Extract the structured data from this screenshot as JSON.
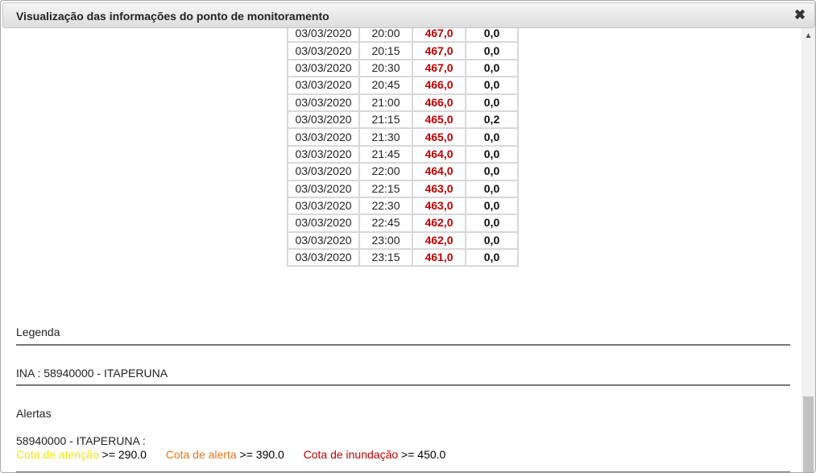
{
  "dialog": {
    "title": "Visualização das informações do ponto de monitoramento",
    "close_glyph": "✖"
  },
  "table": {
    "rows": [
      {
        "date": "03/03/2020",
        "time": "20:00",
        "level": "467,0",
        "rain": "0,0"
      },
      {
        "date": "03/03/2020",
        "time": "20:15",
        "level": "467,0",
        "rain": "0,0"
      },
      {
        "date": "03/03/2020",
        "time": "20:30",
        "level": "467,0",
        "rain": "0,0"
      },
      {
        "date": "03/03/2020",
        "time": "20:45",
        "level": "466,0",
        "rain": "0,0"
      },
      {
        "date": "03/03/2020",
        "time": "21:00",
        "level": "466,0",
        "rain": "0,0"
      },
      {
        "date": "03/03/2020",
        "time": "21:15",
        "level": "465,0",
        "rain": "0,2"
      },
      {
        "date": "03/03/2020",
        "time": "21:30",
        "level": "465,0",
        "rain": "0,0"
      },
      {
        "date": "03/03/2020",
        "time": "21:45",
        "level": "464,0",
        "rain": "0,0"
      },
      {
        "date": "03/03/2020",
        "time": "22:00",
        "level": "464,0",
        "rain": "0,0"
      },
      {
        "date": "03/03/2020",
        "time": "22:15",
        "level": "463,0",
        "rain": "0,0"
      },
      {
        "date": "03/03/2020",
        "time": "22:30",
        "level": "463,0",
        "rain": "0,0"
      },
      {
        "date": "03/03/2020",
        "time": "22:45",
        "level": "462,0",
        "rain": "0,0"
      },
      {
        "date": "03/03/2020",
        "time": "23:00",
        "level": "462,0",
        "rain": "0,0"
      },
      {
        "date": "03/03/2020",
        "time": "23:15",
        "level": "461,0",
        "rain": "0,0"
      }
    ]
  },
  "legend": {
    "heading": "Legenda",
    "station": "INA : 58940000 - ITAPERUNA"
  },
  "alerts": {
    "heading": "Alertas",
    "station": "58940000 - ITAPERUNA :",
    "attention_label": "Cota de atenção",
    "attention_value": " >= 290.0",
    "alert_label": "Cota de alerta",
    "alert_value": " >= 390.0",
    "flood_label": "Cota de inundação",
    "flood_value": " >= 450.0",
    "colors": {
      "attention": "#f5e50a",
      "alert": "#e8761a",
      "flood": "#c00000",
      "level_value": "#c00000"
    }
  },
  "scrollbar": {
    "up_arrow": "▲"
  }
}
